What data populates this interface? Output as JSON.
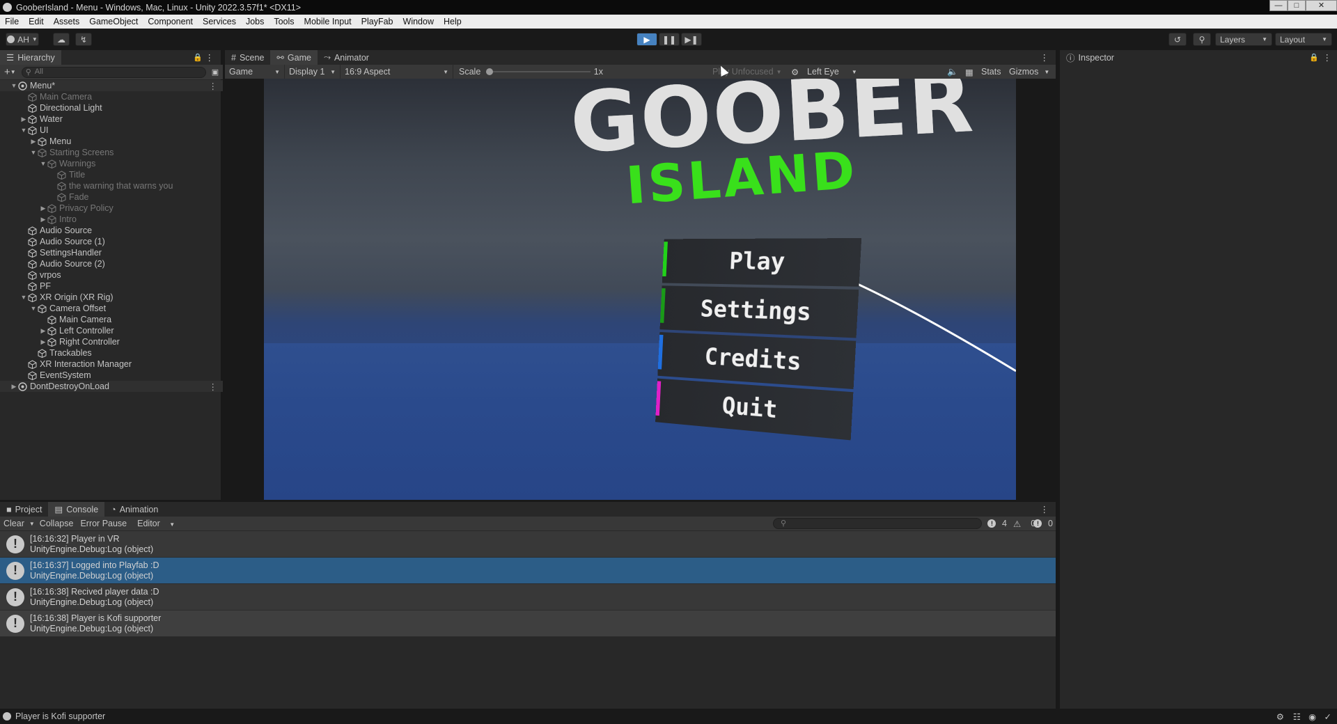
{
  "window": {
    "title": "GooberIsland - Menu - Windows, Mac, Linux - Unity 2022.3.57f1* <DX11>",
    "controls": [
      "minimize",
      "maximize",
      "close"
    ]
  },
  "menubar": [
    "File",
    "Edit",
    "Assets",
    "GameObject",
    "Component",
    "Services",
    "Jobs",
    "Tools",
    "Mobile Input",
    "PlayFab",
    "Window",
    "Help"
  ],
  "toolbar": {
    "account": "AH",
    "layers": "Layers",
    "layout": "Layout"
  },
  "hierarchy": {
    "tab": "Hierarchy",
    "search_placeholder": "All",
    "rows": [
      {
        "label": "Menu*",
        "depth": 0,
        "arrow": "down",
        "dim": false,
        "root": true
      },
      {
        "label": "Main Camera",
        "depth": 1,
        "arrow": "",
        "dim": true
      },
      {
        "label": "Directional Light",
        "depth": 1,
        "arrow": "",
        "dim": false
      },
      {
        "label": "Water",
        "depth": 1,
        "arrow": "right",
        "dim": false
      },
      {
        "label": "UI",
        "depth": 1,
        "arrow": "down",
        "dim": false
      },
      {
        "label": "Menu",
        "depth": 2,
        "arrow": "right",
        "dim": false
      },
      {
        "label": "Starting Screens",
        "depth": 2,
        "arrow": "down",
        "dim": true
      },
      {
        "label": "Warnings",
        "depth": 3,
        "arrow": "down",
        "dim": true
      },
      {
        "label": "Title",
        "depth": 4,
        "arrow": "",
        "dim": true
      },
      {
        "label": "the warning that warns you",
        "depth": 4,
        "arrow": "",
        "dim": true
      },
      {
        "label": "Fade",
        "depth": 4,
        "arrow": "",
        "dim": true
      },
      {
        "label": "Privacy Policy",
        "depth": 3,
        "arrow": "right",
        "dim": true
      },
      {
        "label": "Intro",
        "depth": 3,
        "arrow": "right",
        "dim": true
      },
      {
        "label": "Audio Source",
        "depth": 1,
        "arrow": "",
        "dim": false
      },
      {
        "label": "Audio Source (1)",
        "depth": 1,
        "arrow": "",
        "dim": false
      },
      {
        "label": "SettingsHandler",
        "depth": 1,
        "arrow": "",
        "dim": false
      },
      {
        "label": "Audio Source (2)",
        "depth": 1,
        "arrow": "",
        "dim": false
      },
      {
        "label": "vrpos",
        "depth": 1,
        "arrow": "",
        "dim": false
      },
      {
        "label": "PF",
        "depth": 1,
        "arrow": "",
        "dim": false
      },
      {
        "label": "XR Origin (XR Rig)",
        "depth": 1,
        "arrow": "down",
        "dim": false
      },
      {
        "label": "Camera Offset",
        "depth": 2,
        "arrow": "down",
        "dim": false
      },
      {
        "label": "Main Camera",
        "depth": 3,
        "arrow": "",
        "dim": false
      },
      {
        "label": "Left Controller",
        "depth": 3,
        "arrow": "right",
        "dim": false
      },
      {
        "label": "Right Controller",
        "depth": 3,
        "arrow": "right",
        "dim": false
      },
      {
        "label": "Trackables",
        "depth": 2,
        "arrow": "",
        "dim": false
      },
      {
        "label": "XR Interaction Manager",
        "depth": 1,
        "arrow": "",
        "dim": false
      },
      {
        "label": "EventSystem",
        "depth": 1,
        "arrow": "",
        "dim": false
      },
      {
        "label": "DontDestroyOnLoad",
        "depth": 0,
        "arrow": "right",
        "dim": false,
        "root": true
      }
    ]
  },
  "center": {
    "tabs": [
      "Scene",
      "Game",
      "Animator"
    ],
    "active_tab": "Game",
    "game_toolbar": {
      "mode": "Game",
      "display": "Display 1",
      "aspect": "16:9 Aspect",
      "scale_label": "Scale",
      "scale_value": "1x",
      "play_focus": "Play Unfocused",
      "eye": "Left Eye",
      "stats": "Stats",
      "gizmos": "Gizmos"
    },
    "game": {
      "logo_top": "GOOBER",
      "logo_bottom": "ISLAND",
      "buttons": [
        {
          "label": "Play",
          "color": "#22d21a"
        },
        {
          "label": "Settings",
          "color": "#1a9a18"
        },
        {
          "label": "Credits",
          "color": "#1f6fe0"
        },
        {
          "label": "Quit",
          "color": "#e020c8"
        }
      ]
    }
  },
  "inspector": {
    "tab": "Inspector"
  },
  "bottom": {
    "tabs": [
      "Project",
      "Console",
      "Animation"
    ],
    "active_tab": "Console",
    "toolbar": {
      "clear": "Clear",
      "collapse": "Collapse",
      "error_pause": "Error Pause",
      "editor": "Editor",
      "log_count": "4",
      "warn_count": "0",
      "error_count": "0"
    },
    "logs": [
      {
        "line1": "[16:16:32] Player in VR",
        "line2": "UnityEngine.Debug:Log (object)",
        "selected": false
      },
      {
        "line1": "[16:16:37] Logged into Playfab :D",
        "line2": "UnityEngine.Debug:Log (object)",
        "selected": true
      },
      {
        "line1": "[16:16:38] Recived player data :D",
        "line2": "UnityEngine.Debug:Log (object)",
        "selected": false
      },
      {
        "line1": "[16:16:38] Player is Kofi supporter",
        "line2": "UnityEngine.Debug:Log (object)",
        "selected": false
      }
    ]
  },
  "statusbar": {
    "message": "Player is Kofi supporter"
  }
}
